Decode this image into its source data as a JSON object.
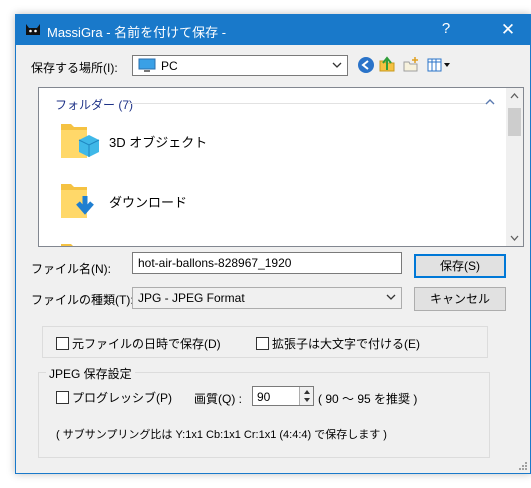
{
  "window": {
    "title": "MassiGra - 名前を付けて保存 -",
    "help_label": "?",
    "close_label": "✕"
  },
  "location": {
    "label": "保存する場所(I):",
    "value": "PC"
  },
  "folder_list": {
    "group_header": "フォルダー (7)",
    "items": [
      {
        "name": "3D オブジェクト"
      },
      {
        "name": "ダウンロード"
      }
    ]
  },
  "filename": {
    "label": "ファイル名(N):",
    "value": "hot-air-ballons-828967_1920"
  },
  "filetype": {
    "label": "ファイルの種類(T):",
    "value": "JPG - JPEG Format"
  },
  "buttons": {
    "save": "保存(S)",
    "cancel": "キャンセル"
  },
  "options": {
    "use_original_datetime": "元ファイルの日時で保存(D)",
    "uppercase_extension": "拡張子は大文字で付ける(E)"
  },
  "jpeg": {
    "group_title": "JPEG 保存設定",
    "progressive_label": "プログレッシブ(P)",
    "quality_label": "画質(Q) :",
    "quality_value": "90",
    "quality_hint": "( 90 ～ 95 を推奨 )",
    "subsampling_note": "( サブサンプリング比は Y:1x1 Cb:1x1 Cr:1x1 (4:4:4) で保存します )"
  },
  "colors": {
    "titlebar": "#1979ca",
    "group_header": "#1e3287",
    "folder_yellow": "#f5c242"
  }
}
